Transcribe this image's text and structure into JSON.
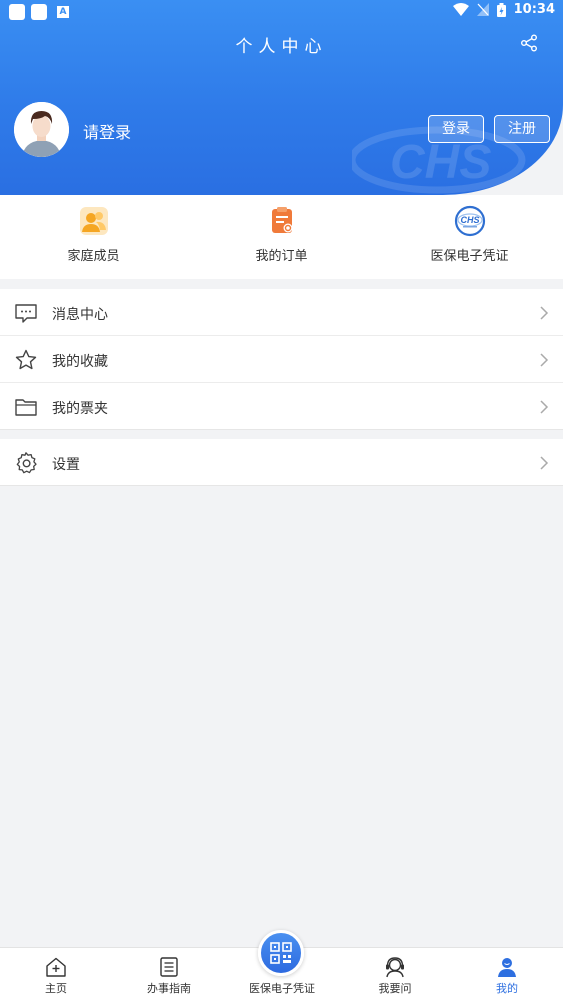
{
  "status_bar": {
    "time": "10:34"
  },
  "header": {
    "title": "个人中心",
    "login_prompt": "请登录",
    "login_button": "登录",
    "register_button": "注册"
  },
  "quick_actions": [
    {
      "label": "家庭成员",
      "icon": "family-icon"
    },
    {
      "label": "我的订单",
      "icon": "order-icon"
    },
    {
      "label": "医保电子凭证",
      "icon": "chs-icon"
    }
  ],
  "menu_group_1": [
    {
      "label": "消息中心",
      "icon": "message-icon"
    },
    {
      "label": "我的收藏",
      "icon": "star-icon"
    },
    {
      "label": "我的票夹",
      "icon": "folder-icon"
    }
  ],
  "menu_group_2": [
    {
      "label": "设置",
      "icon": "gear-icon"
    }
  ],
  "bottom_nav": [
    {
      "label": "主页",
      "icon": "home-icon"
    },
    {
      "label": "办事指南",
      "icon": "guide-icon"
    },
    {
      "label": "医保电子凭证",
      "icon": "qr-code-icon"
    },
    {
      "label": "我要问",
      "icon": "support-icon"
    },
    {
      "label": "我的",
      "icon": "user-icon",
      "active": true
    }
  ],
  "colors": {
    "primary": "#2f7be9",
    "active": "#2e6fe0",
    "accent_orange": "#f6a623"
  }
}
